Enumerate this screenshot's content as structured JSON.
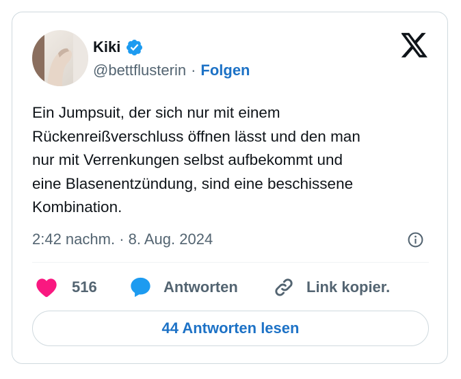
{
  "author": {
    "display_name": "Kiki",
    "handle": "@bettflusterin",
    "separator": "·",
    "follow_label": "Folgen",
    "verified": true
  },
  "tweet": {
    "text": "Ein Jumpsuit, der sich nur mit einem\nRückenreißverschluss öffnen lässt und den man\nnur mit Verrenkungen selbst aufbekommt und\neine Blasenentzündung, sind eine beschissene\nKombination.",
    "timestamp": "2:42 nachm. · 8. Aug. 2024"
  },
  "actions": {
    "like_count": "516",
    "reply_label": "Antworten",
    "copy_link_label": "Link kopier."
  },
  "read_replies_label": "44 Antworten lesen",
  "icons": {
    "logo": "x-logo-icon",
    "verified": "verified-badge-icon",
    "info": "info-icon",
    "like": "heart-icon",
    "reply": "speech-bubble-icon",
    "link": "link-icon"
  },
  "colors": {
    "accent": "#1d72c6",
    "heart": "#f91880",
    "reply_bubble": "#1d9bf0",
    "verified": "#1d9bf0",
    "secondary_text": "#536471",
    "border": "#cfd9de"
  }
}
